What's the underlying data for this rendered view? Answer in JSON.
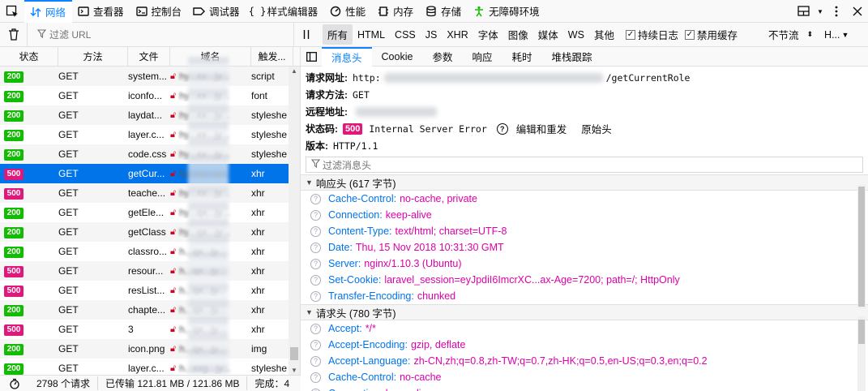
{
  "toolbar": {
    "tools": [
      {
        "label": "网络",
        "icon": "network-icon",
        "active": true
      },
      {
        "label": "查看器",
        "icon": "inspector-icon"
      },
      {
        "label": "控制台",
        "icon": "console-icon"
      },
      {
        "label": "调试器",
        "icon": "debugger-icon"
      },
      {
        "label": "样式编辑器",
        "icon": "style-editor-icon"
      },
      {
        "label": "性能",
        "icon": "performance-icon"
      },
      {
        "label": "内存",
        "icon": "memory-icon"
      },
      {
        "label": "存储",
        "icon": "storage-icon"
      },
      {
        "label": "无障碍环境",
        "icon": "accessibility-icon"
      }
    ]
  },
  "filterbar": {
    "url_placeholder": "过滤 URL",
    "types": [
      "所有",
      "HTML",
      "CSS",
      "JS",
      "XHR",
      "字体",
      "图像",
      "媒体",
      "WS",
      "其他"
    ],
    "persist_logs": "持续日志",
    "disable_cache": "禁用缓存",
    "throttle": "不节流",
    "har": "H..."
  },
  "list": {
    "columns": [
      "状态",
      "方法",
      "文件",
      "域名",
      "触发..."
    ],
    "rows": [
      {
        "status": "200",
        "method": "GET",
        "file": "system...",
        "domain": "hy...xx...jy...",
        "cause": "script"
      },
      {
        "status": "200",
        "method": "GET",
        "file": "iconfo...",
        "domain": "hy...xx...jy...",
        "cause": "font"
      },
      {
        "status": "200",
        "method": "GET",
        "file": "laydat...",
        "domain": "hy...xx...jy...",
        "cause": "styleshe"
      },
      {
        "status": "200",
        "method": "GET",
        "file": "layer.c...",
        "domain": "hy...xx...jy...",
        "cause": "styleshe"
      },
      {
        "status": "200",
        "method": "GET",
        "file": "code.css",
        "domain": "hy...xx...jy...",
        "cause": "styleshe"
      },
      {
        "status": "500",
        "method": "GET",
        "file": "getCur...",
        "domain": "hy...xx...jy...",
        "cause": "xhr",
        "selected": true
      },
      {
        "status": "500",
        "method": "GET",
        "file": "teache...",
        "domain": "hy...xx...jy...",
        "cause": "xhr"
      },
      {
        "status": "200",
        "method": "GET",
        "file": "getEle...",
        "domain": "hy...qx...jy...",
        "cause": "xhr"
      },
      {
        "status": "200",
        "method": "GET",
        "file": "getClass",
        "domain": "hy...qx...jy...",
        "cause": "xhr"
      },
      {
        "status": "200",
        "method": "GET",
        "file": "classro...",
        "domain": "h...qx...jy...",
        "cause": "xhr"
      },
      {
        "status": "500",
        "method": "GET",
        "file": "resour...",
        "domain": "h...qx...jy...",
        "cause": "xhr"
      },
      {
        "status": "500",
        "method": "GET",
        "file": "resList...",
        "domain": "h...qx...jy...",
        "cause": "xhr"
      },
      {
        "status": "200",
        "method": "GET",
        "file": "chapte...",
        "domain": "h...qx...jy...",
        "cause": "xhr"
      },
      {
        "status": "500",
        "method": "GET",
        "file": "3",
        "domain": "h...qx...jy...",
        "cause": "xhr"
      },
      {
        "status": "200",
        "method": "GET",
        "file": "icon.png",
        "domain": "h...qx...jy...",
        "cause": "img"
      },
      {
        "status": "200",
        "method": "GET",
        "file": "layer.c...",
        "domain": "h...xxg...jy...",
        "cause": "styleshe"
      }
    ]
  },
  "statusbar": {
    "requests": "2798 个请求",
    "transferred": "已传输 121.81 MB / 121.86 MB",
    "finish": "完成：4"
  },
  "detail": {
    "tabs": [
      "消息头",
      "Cookie",
      "参数",
      "响应",
      "耗时",
      "堆栈跟踪"
    ],
    "request_url_label": "请求网址:",
    "request_url_prefix": "http:",
    "request_url_suffix": "/getCurrentRole",
    "request_method_label": "请求方法:",
    "request_method": "GET",
    "remote_addr_label": "远程地址:",
    "status_code_label": "状态码:",
    "status_code": "500",
    "status_text": "Internal Server Error",
    "edit_resend": "编辑和重发",
    "raw_headers": "原始头",
    "version_label": "版本:",
    "version": "HTTP/1.1",
    "filter_placeholder": "过滤消息头",
    "response_headers_title": "响应头 (617 字节)",
    "response_headers": [
      {
        "name": "Cache-Control:",
        "value": "no-cache, private"
      },
      {
        "name": "Connection:",
        "value": "keep-alive"
      },
      {
        "name": "Content-Type:",
        "value": "text/html; charset=UTF-8"
      },
      {
        "name": "Date:",
        "value": "Thu, 15 Nov 2018 10:31:30 GMT"
      },
      {
        "name": "Server:",
        "value": "nginx/1.10.3 (Ubuntu)"
      },
      {
        "name": "Set-Cookie:",
        "value": "laravel_session=eyJpdiI6ImcrXC...ax-Age=7200; path=/; HttpOnly"
      },
      {
        "name": "Transfer-Encoding:",
        "value": "chunked"
      }
    ],
    "request_headers_title": "请求头 (780 字节)",
    "request_headers": [
      {
        "name": "Accept:",
        "value": "*/*"
      },
      {
        "name": "Accept-Encoding:",
        "value": "gzip, deflate"
      },
      {
        "name": "Accept-Language:",
        "value": "zh-CN,zh;q=0.8,zh-TW;q=0.7,zh-HK;q=0.5,en-US;q=0.3,en;q=0.2"
      },
      {
        "name": "Cache-Control:",
        "value": "no-cache"
      },
      {
        "name": "Connection:",
        "value": "keep-alive"
      }
    ]
  },
  "colors": {
    "accent": "#0a84ff",
    "ok": "#12bc00",
    "error": "#e0187c",
    "header_name": "#0074e8",
    "header_value": "#dd00a9"
  }
}
